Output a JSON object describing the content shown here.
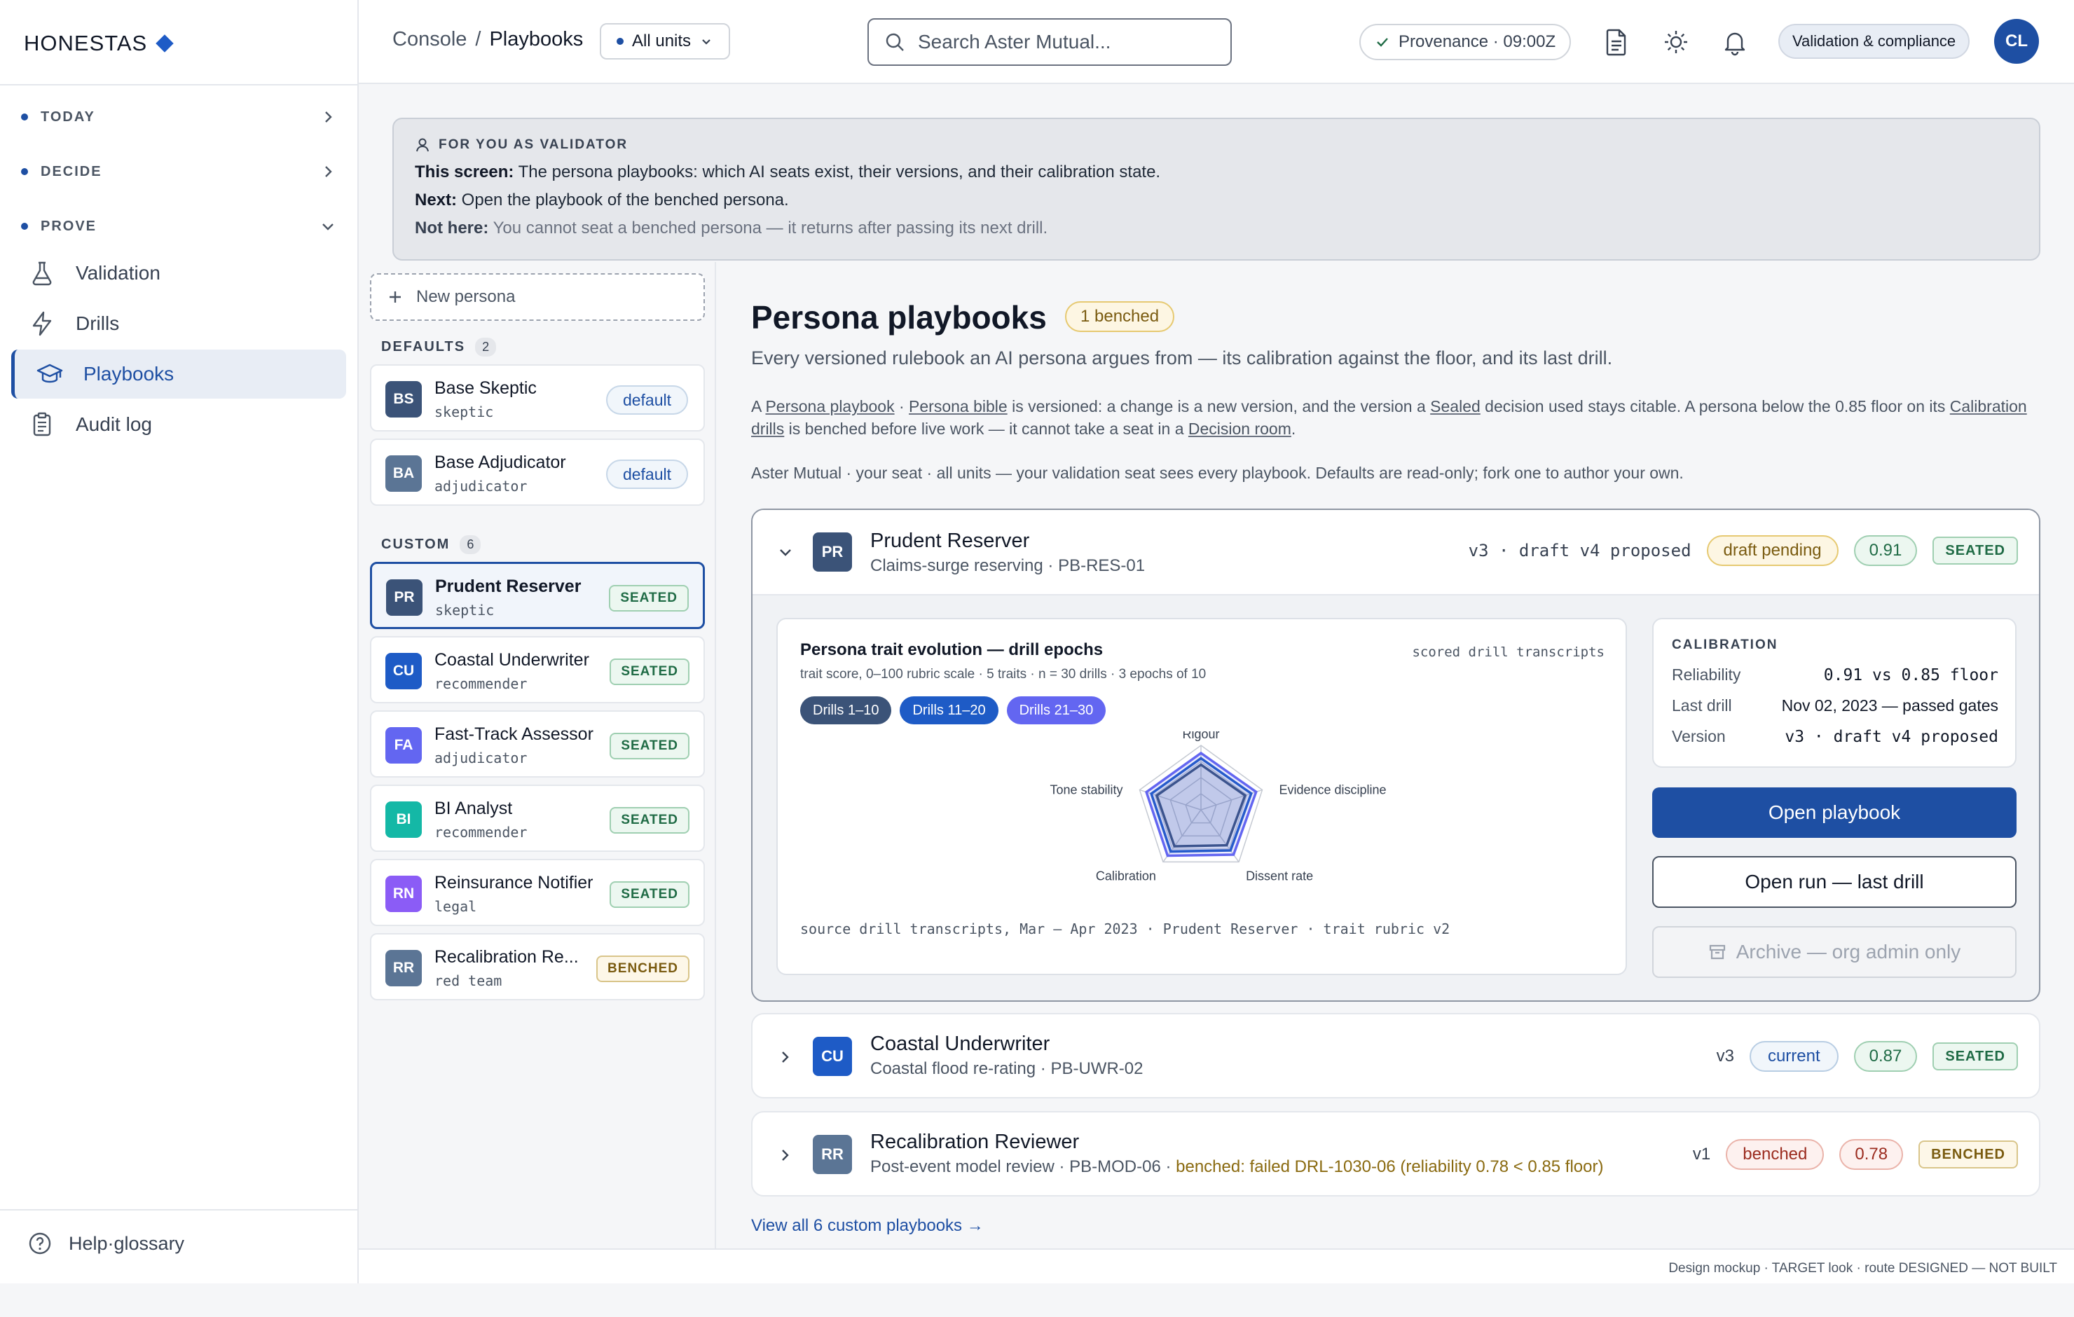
{
  "brand": {
    "name": "HONESTAS"
  },
  "sidebar": {
    "sections": [
      {
        "label": "TODAY"
      },
      {
        "label": "DECIDE"
      },
      {
        "label": "PROVE"
      }
    ],
    "items": [
      {
        "label": "Validation",
        "icon": "flask-icon"
      },
      {
        "label": "Drills",
        "icon": "bolt-icon"
      },
      {
        "label": "Playbooks",
        "icon": "graduation-cap-icon",
        "active": true
      },
      {
        "label": "Audit log",
        "icon": "clipboard-icon"
      }
    ],
    "help": "Help·glossary"
  },
  "topbar": {
    "breadcrumb_root": "Console",
    "breadcrumb_sep": "/",
    "breadcrumb_current": "Playbooks",
    "units": "All units",
    "search_placeholder": "Search Aster Mutual...",
    "provenance": "Provenance · 09:00Z",
    "role": "Validation & compliance",
    "avatar": "CL"
  },
  "banner": {
    "label": "FOR YOU AS VALIDATOR",
    "l1_b": "This screen:",
    "l1": " The persona playbooks: which AI seats exist, their versions, and their calibration state.",
    "l2_b": "Next:",
    "l2": " Open the playbook of the benched persona.",
    "l3_b": "Not here:",
    "l3": " You cannot seat a benched persona — it returns after passing its next drill."
  },
  "list": {
    "new_label": "New persona",
    "defaults_label": "DEFAULTS",
    "defaults_count": "2",
    "custom_label": "CUSTOM",
    "custom_count": "6",
    "defaults": [
      {
        "initials": "BS",
        "name": "Base Skeptic",
        "role": "skeptic",
        "tag": "default",
        "color": "#3b5378"
      },
      {
        "initials": "BA",
        "name": "Base Adjudicator",
        "role": "adjudicator",
        "tag": "default",
        "color": "#5b7595"
      }
    ],
    "custom": [
      {
        "initials": "PR",
        "name": "Prudent Reserver",
        "role": "skeptic",
        "tag": "SEATED",
        "color": "#3b5378"
      },
      {
        "initials": "CU",
        "name": "Coastal Underwriter",
        "role": "recommender",
        "tag": "SEATED",
        "color": "#1e5bc6"
      },
      {
        "initials": "FA",
        "name": "Fast-Track Assessor",
        "role": "adjudicator",
        "tag": "SEATED",
        "color": "#6366f1"
      },
      {
        "initials": "BI",
        "name": "BI Analyst",
        "role": "recommender",
        "tag": "SEATED",
        "color": "#14b8a6"
      },
      {
        "initials": "RN",
        "name": "Reinsurance Notifier",
        "role": "legal",
        "tag": "SEATED",
        "color": "#8b5cf6"
      },
      {
        "initials": "RR",
        "name": "Recalibration Re...",
        "role": "red team",
        "tag": "BENCHED",
        "color": "#5b7595"
      }
    ]
  },
  "main": {
    "title": "Persona playbooks",
    "title_badge": "1 benched",
    "subtitle": "Every versioned rulebook an AI persona argues from — its calibration against the floor, and its last drill.",
    "desc_1": "A ",
    "desc_term1": "Persona playbook",
    "desc_sep": " · ",
    "desc_term2": "Persona bible",
    "desc_2": " is versioned: a change is a new version, and the version a ",
    "desc_term3": "Sealed",
    "desc_3": " decision used stays citable. A persona below the 0.85 floor on its ",
    "desc_term4": "Calibration drills",
    "desc_4": " is benched before live work — it cannot take a seat in a ",
    "desc_term5": "Decision room",
    "desc_5": ".",
    "scope": "Aster Mutual · your seat · all units — your validation seat sees every playbook. Defaults are read-only; fork one to author your own.",
    "expanded": {
      "initials": "PR",
      "name": "Prudent Reserver",
      "sub": "Claims-surge reserving · PB-RES-01",
      "version": "v3 · draft v4 proposed",
      "status": "draft pending",
      "score": "0.91",
      "tag": "SEATED"
    },
    "calibration": {
      "title": "CALIBRATION",
      "rows": [
        {
          "k": "Reliability",
          "v": "0.91 vs 0.85 floor"
        },
        {
          "k": "Last drill",
          "v": "Nov 02, 2023 — passed gates"
        },
        {
          "k": "Version",
          "v": "v3 · draft v4 proposed"
        }
      ]
    },
    "actions": {
      "open_playbook": "Open playbook",
      "open_run": "Open run — last drill",
      "archive": "Archive — org admin only"
    },
    "rows": [
      {
        "initials": "CU",
        "name": "Coastal Underwriter",
        "sub": "Coastal flood re-rating · PB-UWR-02",
        "version": "v3",
        "status": "current",
        "score": "0.87",
        "tag": "SEATED",
        "color": "#1e5bc6"
      },
      {
        "initials": "RR",
        "name": "Recalibration Reviewer",
        "sub": "Post-event model review · PB-MOD-06 · ",
        "warn": "benched: failed DRL-1030-06 (reliability 0.78 < 0.85 floor)",
        "version": "v1",
        "status": "benched",
        "score": "0.78",
        "tag": "BENCHED",
        "color": "#5b7595"
      }
    ],
    "view_all": "View all 6 custom playbooks →"
  },
  "chart_data": {
    "type": "radar",
    "title": "Persona trait evolution — drill epochs",
    "subtitle": "trait score, 0–100 rubric scale · 5 traits · n = 30 drills · 3 epochs of 10",
    "right_note": "scored drill transcripts",
    "source": "source drill transcripts, Mar – Apr 2023 · Prudent Reserver · trait rubric v2",
    "axes": [
      "Rigour",
      "Evidence discipline",
      "Dissent rate",
      "Calibration",
      "Tone stability"
    ],
    "range": [
      0,
      100
    ],
    "series": [
      {
        "name": "Drills 1–10",
        "values": [
          70,
          72,
          68,
          70,
          72
        ],
        "color": "#3b5378"
      },
      {
        "name": "Drills 11–20",
        "values": [
          80,
          82,
          78,
          80,
          81
        ],
        "color": "#1e5bc6"
      },
      {
        "name": "Drills 21–30",
        "values": [
          88,
          90,
          86,
          88,
          89
        ],
        "color": "#6366f1"
      }
    ]
  },
  "footer": "Design mockup · TARGET look · route DESIGNED — NOT BUILT"
}
